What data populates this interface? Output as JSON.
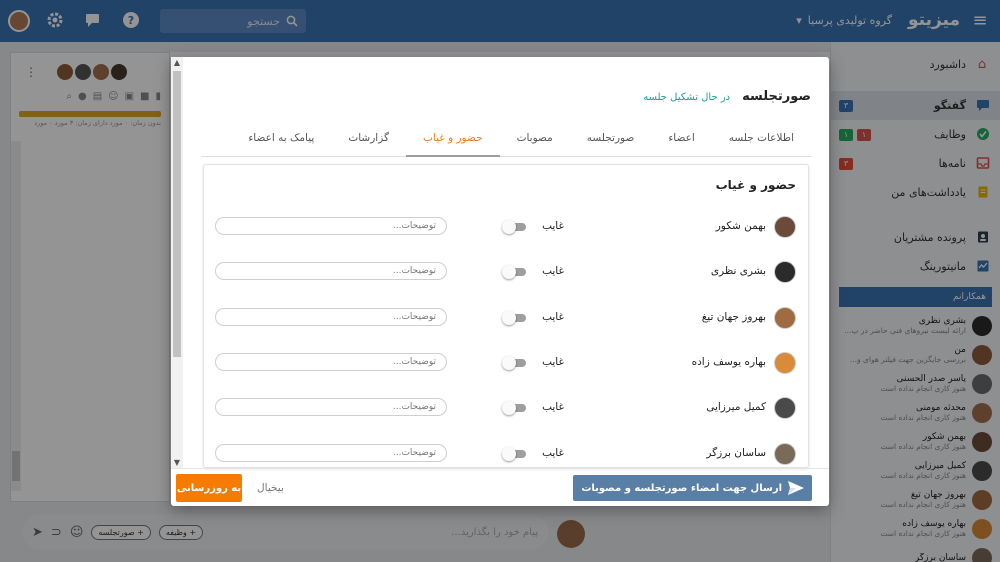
{
  "topbar": {
    "logo": "میزیتو",
    "org": "گروه تولیدی پرسیا",
    "search_placeholder": "جستجو",
    "icons": [
      "menu-icon",
      "chevron-down-icon",
      "search-icon",
      "help-icon",
      "chat-icon",
      "gear-icon"
    ]
  },
  "sidebar": {
    "items": [
      {
        "label": "داشبورد",
        "icon": "home-icon",
        "color": "#d9534f"
      },
      {
        "label": "گفتگو",
        "icon": "chat-icon",
        "color": "#3b74b4",
        "badges": [
          {
            "text": "۳",
            "color": "#3b74b4"
          }
        ]
      },
      {
        "label": "وظایف",
        "icon": "check-circle-icon",
        "color": "#27ae60",
        "badges": [
          {
            "text": "۱",
            "color": "#27ae60"
          },
          {
            "text": "۱",
            "color": "#d9534f"
          }
        ]
      },
      {
        "label": "نامه‌ها",
        "icon": "inbox-icon",
        "color": "#d9534f",
        "badges": [
          {
            "text": "۳",
            "color": "#e74c3c"
          }
        ]
      },
      {
        "label": "یادداشت‌های من",
        "icon": "note-icon",
        "color": "#e6b800"
      },
      {
        "label": "پرونده مشتریان",
        "icon": "contact-card-icon",
        "color": "#2c3e50"
      },
      {
        "label": "مانیتورینگ",
        "icon": "monitor-icon",
        "color": "#3b74b4"
      }
    ],
    "colleagues_title": "همکارانم",
    "colleagues": [
      {
        "name": "بشری نظری",
        "status": "ارائه لیست نیروهای فنی حاضر در پ..."
      },
      {
        "name": "من",
        "status": "بررسی جایگزین جهت فیلتر هوای و..."
      },
      {
        "name": "یاسر صدر الحسنی",
        "status": "هنوز کاری انجام نداده است"
      },
      {
        "name": "محدثه مومنی",
        "status": "هنوز کاری انجام نداده است"
      },
      {
        "name": "بهمن شکور",
        "status": "هنوز کاری انجام نداده است"
      },
      {
        "name": "کمیل میرزایی",
        "status": "هنوز کاری انجام نداده است"
      },
      {
        "name": "بهروز جهان تیغ",
        "status": "هنوز کاری انجام نداده است"
      },
      {
        "name": "بهاره یوسف زاده",
        "status": "هنوز کاری انجام نداده است"
      },
      {
        "name": "ساسان برزگر",
        "status": ""
      }
    ]
  },
  "chat": {
    "meta": "بدون زمان: ۰ مورد   دارای زمان: ۳ مورد   ۰ مورد",
    "composer_placeholder": "پیام خود را بگذارید...",
    "chip_task": "+ وظیفه",
    "chip_minutes": "+ صورتجلسه"
  },
  "modal": {
    "title": "صورتجلسه",
    "status": "در حال تشکیل جلسه",
    "tabs": [
      "اطلاعات جلسه",
      "اعضاء",
      "صورتجلسه",
      "مصوبات",
      "حضور و غیاب",
      "گزارشات",
      "پیامک به اعضاء"
    ],
    "active_tab": 4,
    "card_title": "حضور و غیاب",
    "absent_label": "غایب",
    "notes_placeholder": "توضیحات...",
    "attendees": [
      {
        "name": "بهمن شکور",
        "absent": false,
        "color": "#6b4a3a"
      },
      {
        "name": "بشری نظری",
        "absent": false,
        "color": "#2b2b2b"
      },
      {
        "name": "بهروز جهان تیغ",
        "absent": false,
        "color": "#a06b3f"
      },
      {
        "name": "بهاره یوسف زاده",
        "absent": false,
        "color": "#d98b3a"
      },
      {
        "name": "کمیل میرزایی",
        "absent": false,
        "color": "#4a4a4a"
      },
      {
        "name": "ساسان برزگر",
        "absent": false,
        "color": "#7a6a5a"
      }
    ],
    "send_button": "ارسال جهت امضاء صورتجلسه و مصوبات",
    "cancel_button": "بیخیال",
    "update_button": "به روزرسانی"
  }
}
